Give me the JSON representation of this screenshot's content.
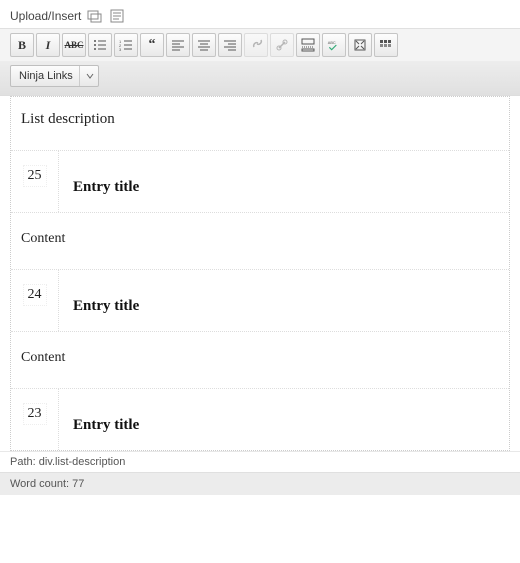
{
  "upload": {
    "label": "Upload/Insert"
  },
  "dropdown": {
    "label": "Ninja Links"
  },
  "editor": {
    "list_description": "List description",
    "entries": [
      {
        "num": "25",
        "title": "Entry title",
        "content": "Content"
      },
      {
        "num": "24",
        "title": "Entry title",
        "content": "Content"
      },
      {
        "num": "23",
        "title": "Entry title"
      }
    ]
  },
  "path": {
    "prefix": "Path: ",
    "value": "div.list-description"
  },
  "wordcount": {
    "prefix": "Word count: ",
    "value": "77"
  }
}
